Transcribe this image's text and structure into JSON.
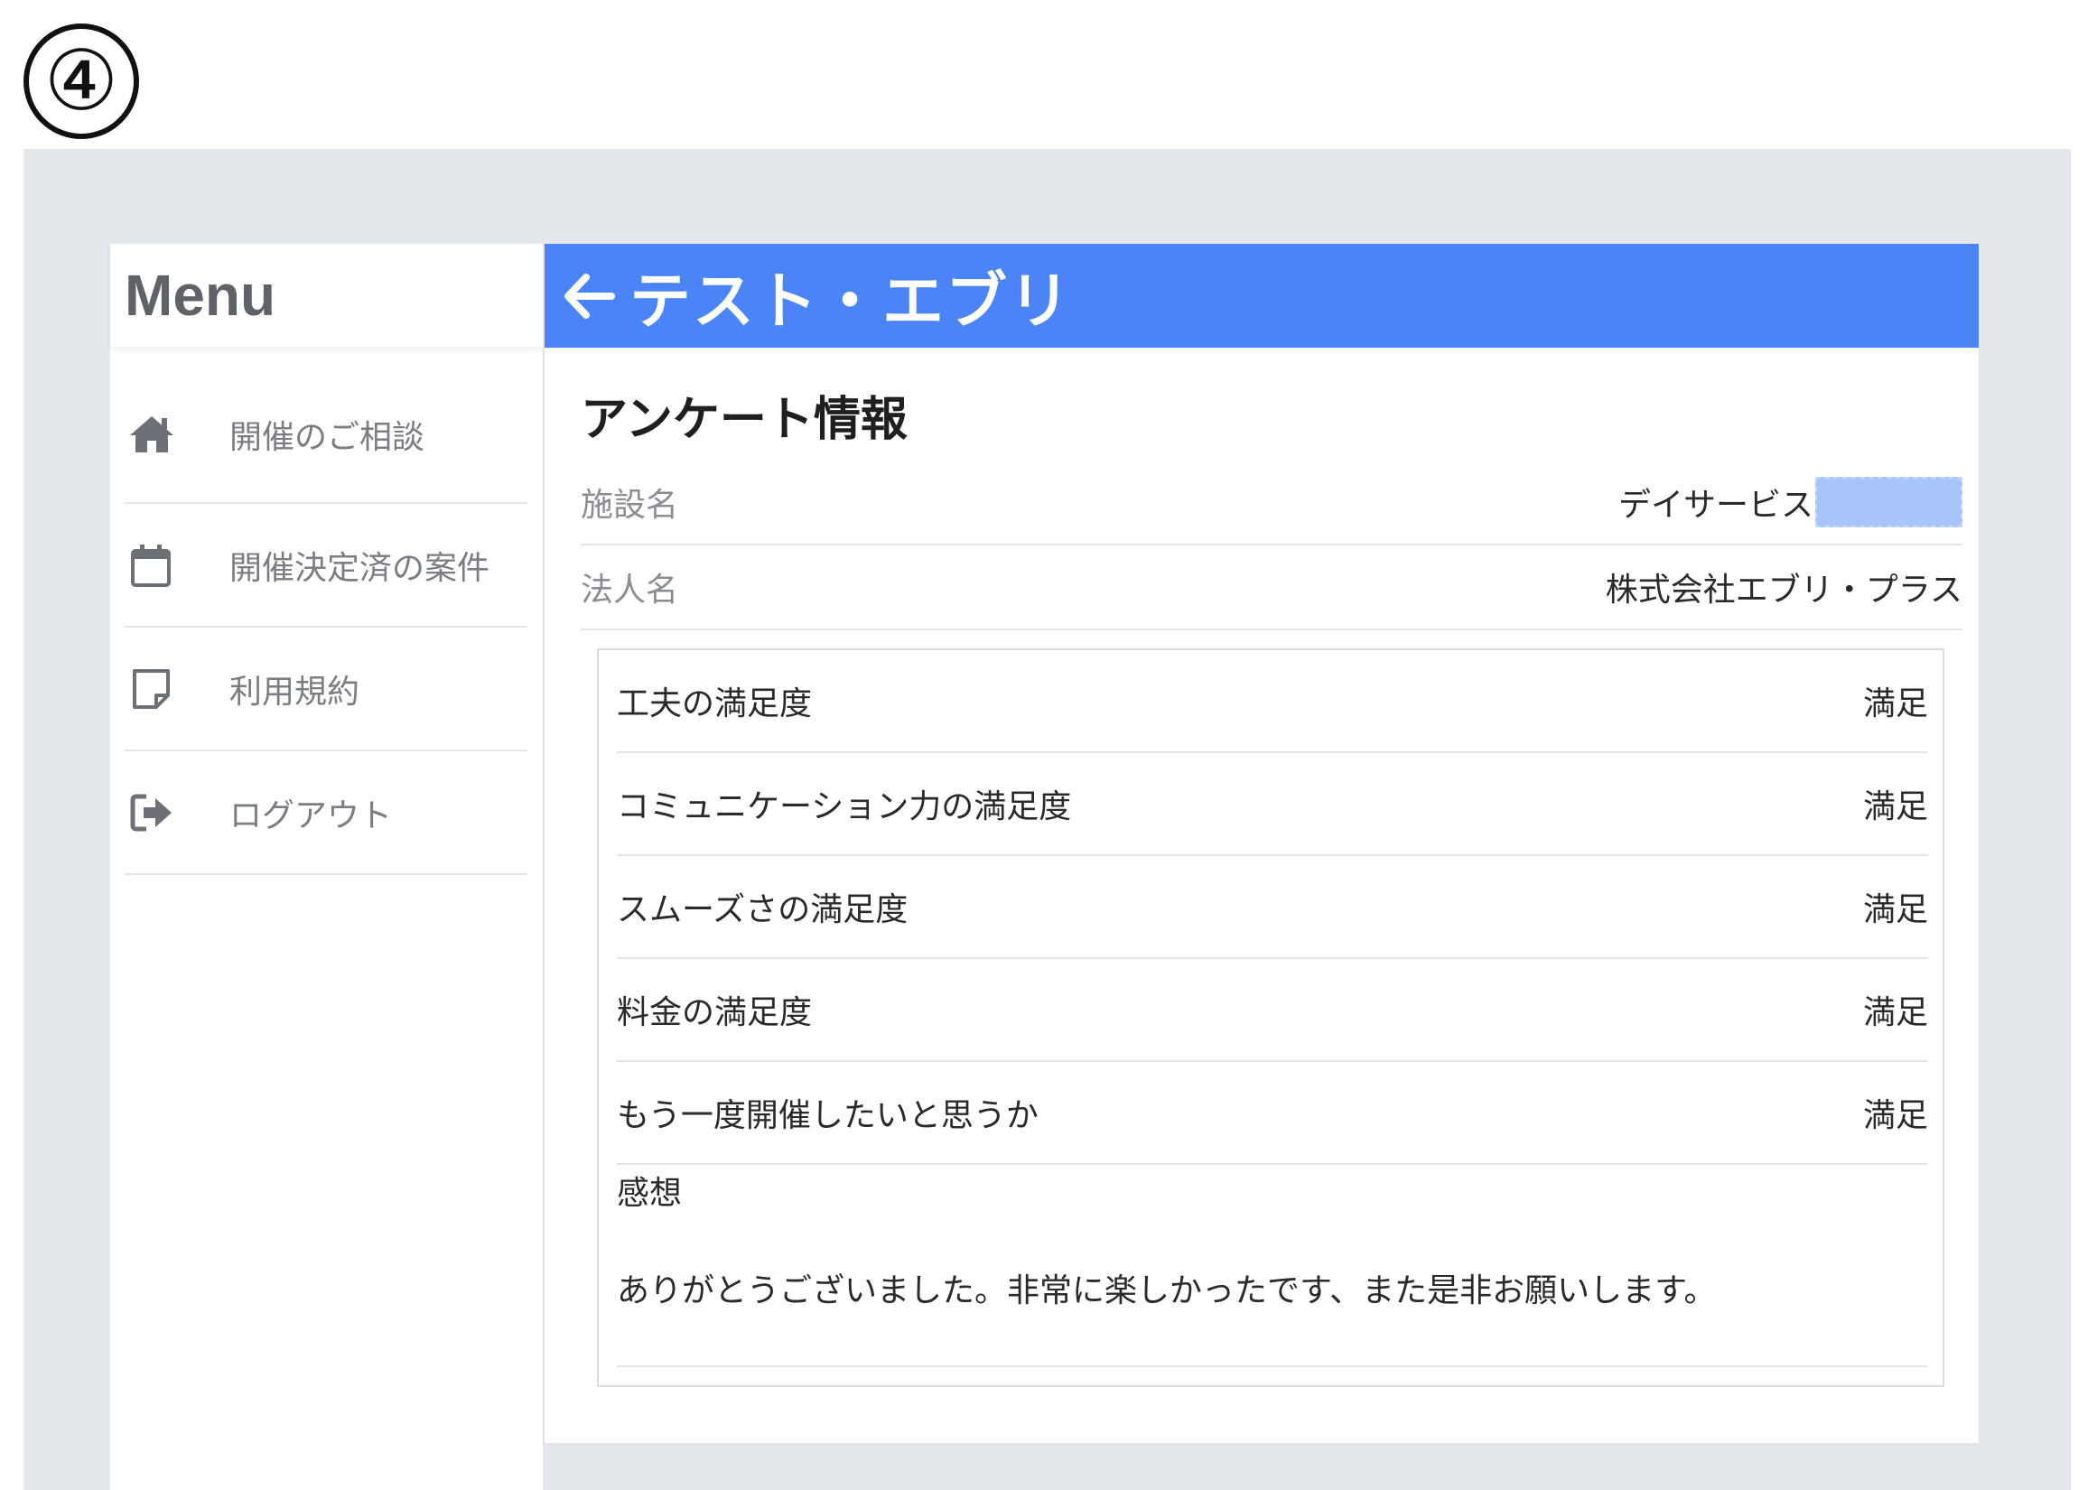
{
  "step": {
    "number": "④"
  },
  "sidebar": {
    "title": "Menu",
    "items": [
      {
        "label": "開催のご相談",
        "icon": "home-icon"
      },
      {
        "label": "開催決定済の案件",
        "icon": "calendar-icon"
      },
      {
        "label": "利用規約",
        "icon": "note-icon"
      },
      {
        "label": "ログアウト",
        "icon": "logout-icon"
      }
    ]
  },
  "header": {
    "title": "テスト・エブリ",
    "back_icon": "arrow-left-icon",
    "color": "#4a84f7"
  },
  "survey_info": {
    "title": "アンケート情報",
    "facility_label": "施設名",
    "facility_value": "デイサービス",
    "corporation_label": "法人名",
    "corporation_value": "株式会社エブリ・プラス"
  },
  "answers": [
    {
      "question": "工夫の満足度",
      "answer": "満足"
    },
    {
      "question": "コミュニケーション力の満足度",
      "answer": "満足"
    },
    {
      "question": "スムーズさの満足度",
      "answer": "満足"
    },
    {
      "question": "料金の満足度",
      "answer": "満足"
    },
    {
      "question": "もう一度開催したいと思うか",
      "answer": "満足"
    }
  ],
  "impression": {
    "label": "感想",
    "text": "ありがとうございました。非常に楽しかったです、また是非お願いします。"
  }
}
